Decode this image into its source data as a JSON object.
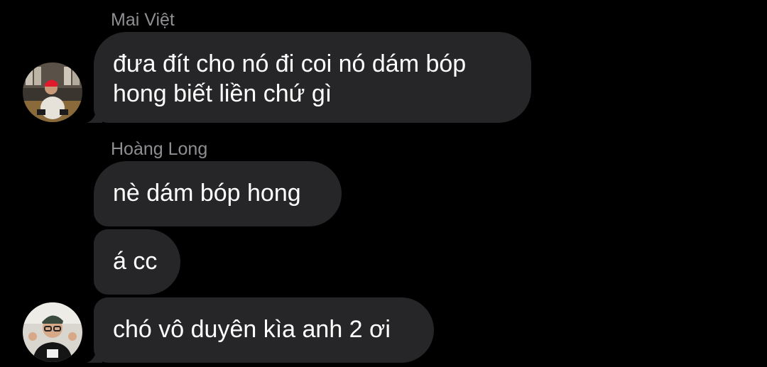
{
  "messages": [
    {
      "sender": "Mai Việt",
      "avatar_icon": "user-photo-red-cap-icon",
      "bubbles": [
        {
          "lines": [
            "đưa đít cho nó đi coi nó dám bóp",
            "hong biết liền chứ gì"
          ]
        }
      ]
    },
    {
      "sender": "Hoàng Long",
      "avatar_icon": "user-photo-glasses-cap-icon",
      "bubbles": [
        {
          "lines": [
            "nè dám bóp hong"
          ]
        },
        {
          "lines": [
            "á cc"
          ]
        },
        {
          "lines": [
            "chó vô duyên kìa anh 2 ơi"
          ]
        }
      ]
    }
  ],
  "colors": {
    "background": "#000000",
    "bubble": "#262628",
    "text": "#ffffff",
    "sender_name": "#8e8e93"
  }
}
